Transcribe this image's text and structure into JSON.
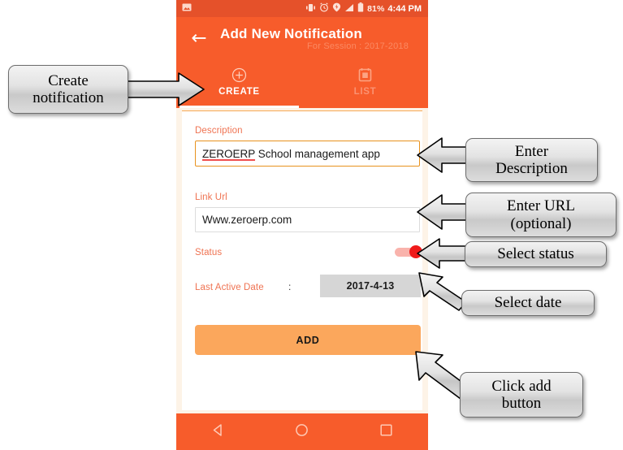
{
  "phone": {
    "statusbar": {
      "left_icon": "image-icon",
      "icons": [
        "vibrate-icon",
        "alarm-clock-icon",
        "location-icon",
        "signal-icon",
        "battery-icon"
      ],
      "battery_percent": "81%",
      "time": "4:44 PM"
    },
    "appbar": {
      "back_icon": "back-arrow-icon",
      "title": "Add New Notification",
      "subtitle": "For Session : 2017-2018"
    },
    "tabs": [
      {
        "label": "CREATE",
        "icon": "plus-circle-icon",
        "active": true
      },
      {
        "label": "LIST",
        "icon": "calendar-list-icon",
        "active": false
      }
    ],
    "form": {
      "description_label": "Description",
      "description_value_misspelled": "ZEROERP",
      "description_value_rest": " School management app",
      "link_label": "Link Url",
      "link_value": "Www.zeroerp.com",
      "status_label": "Status",
      "status_toggle_state": "on",
      "date_label": "Last Active Date",
      "date_separator": ":",
      "date_value": "2017-4-13",
      "add_button_label": "ADD"
    },
    "navbar": [
      "back-triangle-icon",
      "home-circle-icon",
      "recents-square-icon"
    ]
  },
  "callouts": {
    "create_notification": "Create\nnotification",
    "enter_description": "Enter\nDescription",
    "enter_url": "Enter URL\n(optional)",
    "select_status": "Select status",
    "select_date": "Select date",
    "click_add": "Click add\nbutton"
  },
  "colors": {
    "app_orange": "#f75c2b",
    "statusbar_orange": "#e5512a",
    "add_button_orange": "#fba75c",
    "label_orange": "#ef7352",
    "toggle_red": "#f01b1b",
    "date_gray": "#d6d6d6",
    "panel_cream": "#fdf3e7"
  }
}
